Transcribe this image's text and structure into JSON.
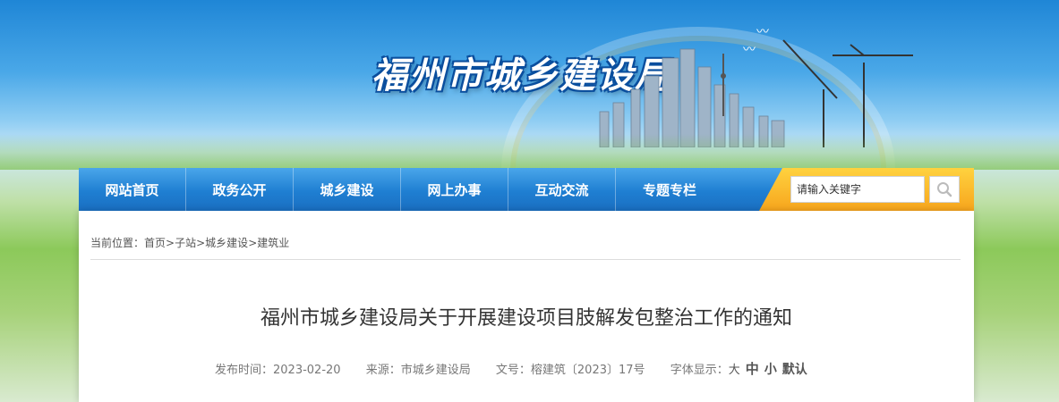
{
  "banner": {
    "logo_text": "福州市城乡建设局"
  },
  "nav": {
    "items": [
      "网站首页",
      "政务公开",
      "城乡建设",
      "网上办事",
      "互动交流",
      "专题专栏"
    ],
    "search_placeholder": "请输入关键字"
  },
  "breadcrumb": {
    "prefix": "当前位置：",
    "items": [
      "首页",
      "子站",
      "城乡建设",
      "建筑业"
    ],
    "separator": ">"
  },
  "article": {
    "title": "福州市城乡建设局关于开展建设项目肢解发包整治工作的通知",
    "publish_label": "发布时间：",
    "publish_date": "2023-02-20",
    "source_label": "来源：",
    "source": "市城乡建设局",
    "doc_label": "文号：",
    "doc_no": "榕建筑〔2023〕17号",
    "font_label": "字体显示：",
    "font_large": "大",
    "font_medium": "中",
    "font_small": "小",
    "font_default": "默认"
  },
  "colors": {
    "nav_blue": "#1f7fd2",
    "search_orange": "#f7a51d",
    "title_text": "#333333"
  }
}
